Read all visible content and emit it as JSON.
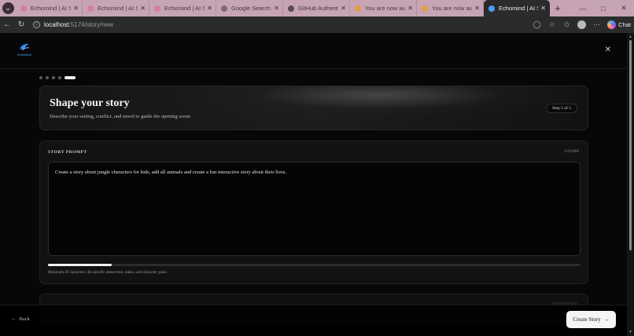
{
  "browser": {
    "tabs": [
      {
        "title": "Echomind | AI Story",
        "favicon_color": "#d47fa0"
      },
      {
        "title": "Echomind | AI Story",
        "favicon_color": "#d47fa0"
      },
      {
        "title": "Echomind | AI Story",
        "favicon_color": "#d47fa0"
      },
      {
        "title": "Google Search - To",
        "favicon_color": "#7a6a72"
      },
      {
        "title": "GitHub Authenticat",
        "favicon_color": "#5a4a52"
      },
      {
        "title": "You are now autho",
        "favicon_color": "#e0a040"
      },
      {
        "title": "You are now autho",
        "favicon_color": "#e0a040"
      },
      {
        "title": "Echomind | AI Story",
        "favicon_color": "#4a9cff",
        "active": true
      }
    ],
    "url_host": "localhost",
    "url_path": ":5174/story/new",
    "chat_label": "Chat"
  },
  "app": {
    "brand": "EchoMind",
    "steps_total": 5,
    "current_step": 5,
    "hero": {
      "title": "Shape your story",
      "subtitle": "Describe your setting, conflict, and mood to guide the opening scene.",
      "step_badge": "Step 5 of 5"
    },
    "prompt": {
      "label": "STORY PROMPT",
      "count": "110/3000",
      "value": "Create a story about jungle characters for kids, add all animals and create a fun interactive story about their lives.",
      "progress_fraction": 0.12,
      "hint": "Minimum 20 characters. Be specific about tone, stakes, and character goals."
    },
    "footer": {
      "back_label": "Back",
      "create_label": "Create Story"
    }
  },
  "colors": {
    "tabbar": "#c7a4b3",
    "page_bg": "#070707",
    "accent": "#f4f4f4"
  }
}
